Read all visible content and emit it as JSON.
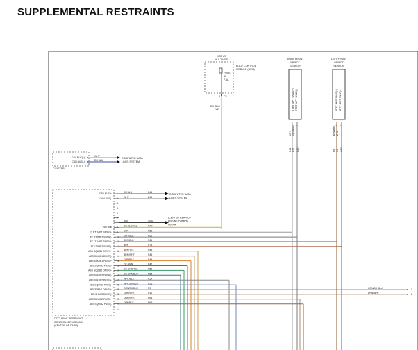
{
  "title": "SUPPLEMENTAL RESTRAINTS",
  "bcm": {
    "hot_label": [
      "HOT AT",
      "ALL TIMES"
    ],
    "name": [
      "BODY CONTROL",
      "MODULE (BCM)"
    ],
    "fuse": [
      "FUSE",
      "40",
      "7.5A"
    ],
    "pin": "3",
    "connector": "C2",
    "wire_color": [
      "DK BLU/",
      "YEL"
    ]
  },
  "right_sensor": {
    "name": [
      "RIGHT FRONT",
      "IMPACT",
      "SENSOR"
    ],
    "pins": [
      "2",
      "1"
    ],
    "pin_labels": [
      "FT RT IMPT SNSR(+)",
      "FT RT IMPT SNSR(-)"
    ],
    "wire_colors": [
      "GRY",
      "GRY/BLK"
    ],
    "circuits": [
      "R13",
      "R22"
    ],
    "connector": "C301"
  },
  "left_sensor": {
    "name": [
      "LEFT FRONT",
      "IMPACT",
      "SENSOR"
    ],
    "pins": [
      "2",
      "1"
    ],
    "pin_labels": [
      "LT FT IMPT SNSR(+)",
      "LT FT IMPT SNSR(-)"
    ],
    "wire_colors": [
      "BRN/BLK",
      "BRN"
    ],
    "circuits": [
      "R8",
      "R4"
    ],
    "connector": "C302"
  },
  "cluster": {
    "name": "CLUSTER",
    "pins": [
      {
        "label": "CAN BUS(+)",
        "color": "WHT",
        "dest": [
          "COMPUTER DATA",
          "LINES SYSTEM"
        ]
      },
      {
        "label": "CAN BUS(-)",
        "color": "DK BLU"
      }
    ]
  },
  "orc": {
    "name": [
      "OCCUPANT RESTRAINT",
      "CONTROLLER MODULE",
      "(CENTER OF DASH)"
    ],
    "ground_dest": [
      "(CENTER REAR OF",
      "ENGINE COMPT)",
      "G024A"
    ],
    "data_dest": [
      "COMPUTER DATA",
      "LINES SYSTEM"
    ],
    "pins": [
      {
        "label": "CAN BUS(+)",
        "pin": "1",
        "color": "DK BLU",
        "circuit": "D41"
      },
      {
        "label": "CAN BUS(-)",
        "pin": "2",
        "color": "WHT",
        "circuit": "D42"
      },
      {
        "label": "",
        "pin": "3",
        "color": "",
        "circuit": ""
      },
      {
        "label": "",
        "pin": "4",
        "color": "",
        "circuit": ""
      },
      {
        "label": "",
        "pin": "5",
        "color": "",
        "circuit": ""
      },
      {
        "label": "",
        "pin": "6",
        "color": "",
        "circuit": ""
      },
      {
        "label": "",
        "pin": "7",
        "color": "BLK",
        "circuit": "Z634"
      },
      {
        "label": "IGN RUN",
        "pin": "8",
        "color": "DK BLU/YEL",
        "circuit": "F724"
      },
      {
        "label": "FT RT IMPT SNSR(+)",
        "pin": "9",
        "color": "GRY",
        "circuit": "R60"
      },
      {
        "label": "FT RT IMPT SNSR(-)",
        "pin": "10",
        "color": "GRY/BLK",
        "circuit": "R62"
      },
      {
        "label": "FT LT IMPT SNSR(+)",
        "pin": "11",
        "color": "BRN/BLK",
        "circuit": "R61"
      },
      {
        "label": "FT LT IMPT SNSR(-)",
        "pin": "12",
        "color": "BRN",
        "circuit": "R73"
      },
      {
        "label": "ABS SQUIB1 DRVR(+)",
        "pin": "13",
        "color": "BRN/YEL",
        "circuit": "R43"
      },
      {
        "label": "ABS SQUIB1 DRVR(-)",
        "pin": "14",
        "color": "BRN/WHT",
        "circuit": "R45"
      },
      {
        "label": "ABS SQUIB1 PASS(+)",
        "pin": "15",
        "color": "ORN/BLK",
        "circuit": "R44"
      },
      {
        "label": "ABS SQUIB1 PASS(-)",
        "pin": "16",
        "color": "DK GRN",
        "circuit": "R42"
      },
      {
        "label": "ABS SQUIB2 DRVR(+)",
        "pin": "17",
        "color": "DK GRN/TEL",
        "circuit": "R51"
      },
      {
        "label": "ABS SQUIB2 DRVR(-)",
        "pin": "18",
        "color": "DK GRN/BLU",
        "circuit": "R53"
      },
      {
        "label": "ABS SQUIB2 PASS(+)",
        "pin": "19",
        "color": "WHT/BLK",
        "circuit": "R54"
      },
      {
        "label": "ABS SQUIB2 PASS(-)",
        "pin": "20",
        "color": "WHT/DK BLU",
        "circuit": "R55"
      },
      {
        "label": "BRKE BAG DRVR(+)",
        "pin": "21",
        "color": "ORN/DK BLU",
        "circuit": "R9"
      },
      {
        "label": "BRKE BAG DRVR(-)",
        "pin": "22",
        "color": "DRN/WHT",
        "circuit": "R11"
      },
      {
        "label": "ABS SQUIB2 PASS(+)",
        "pin": "23",
        "color": "DRN/WHT",
        "circuit": "R68"
      },
      {
        "label": "ABS SQUIB2 PASS(-)",
        "pin": "24",
        "color": "DRN/BLK",
        "circuit": "R69"
      }
    ],
    "connector": "C1"
  },
  "offpage": [
    {
      "color": "ORN/DK BLU",
      "ref": "1"
    },
    {
      "color": "DRN/WHT",
      "ref": "2"
    }
  ]
}
